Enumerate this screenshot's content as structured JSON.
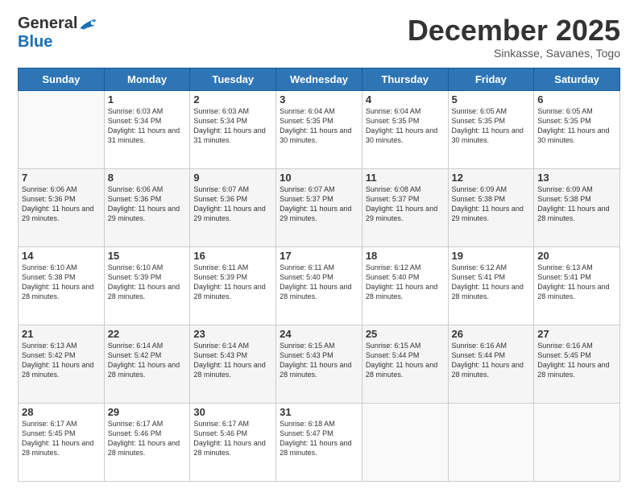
{
  "logo": {
    "general": "General",
    "blue": "Blue"
  },
  "title": "December 2025",
  "location": "Sinkasse, Savanes, Togo",
  "days_of_week": [
    "Sunday",
    "Monday",
    "Tuesday",
    "Wednesday",
    "Thursday",
    "Friday",
    "Saturday"
  ],
  "weeks": [
    [
      {
        "day": "",
        "sunrise": "",
        "sunset": "",
        "daylight": ""
      },
      {
        "day": "1",
        "sunrise": "Sunrise: 6:03 AM",
        "sunset": "Sunset: 5:34 PM",
        "daylight": "Daylight: 11 hours and 31 minutes."
      },
      {
        "day": "2",
        "sunrise": "Sunrise: 6:03 AM",
        "sunset": "Sunset: 5:34 PM",
        "daylight": "Daylight: 11 hours and 31 minutes."
      },
      {
        "day": "3",
        "sunrise": "Sunrise: 6:04 AM",
        "sunset": "Sunset: 5:35 PM",
        "daylight": "Daylight: 11 hours and 30 minutes."
      },
      {
        "day": "4",
        "sunrise": "Sunrise: 6:04 AM",
        "sunset": "Sunset: 5:35 PM",
        "daylight": "Daylight: 11 hours and 30 minutes."
      },
      {
        "day": "5",
        "sunrise": "Sunrise: 6:05 AM",
        "sunset": "Sunset: 5:35 PM",
        "daylight": "Daylight: 11 hours and 30 minutes."
      },
      {
        "day": "6",
        "sunrise": "Sunrise: 6:05 AM",
        "sunset": "Sunset: 5:35 PM",
        "daylight": "Daylight: 11 hours and 30 minutes."
      }
    ],
    [
      {
        "day": "7",
        "sunrise": "Sunrise: 6:06 AM",
        "sunset": "Sunset: 5:36 PM",
        "daylight": "Daylight: 11 hours and 29 minutes."
      },
      {
        "day": "8",
        "sunrise": "Sunrise: 6:06 AM",
        "sunset": "Sunset: 5:36 PM",
        "daylight": "Daylight: 11 hours and 29 minutes."
      },
      {
        "day": "9",
        "sunrise": "Sunrise: 6:07 AM",
        "sunset": "Sunset: 5:36 PM",
        "daylight": "Daylight: 11 hours and 29 minutes."
      },
      {
        "day": "10",
        "sunrise": "Sunrise: 6:07 AM",
        "sunset": "Sunset: 5:37 PM",
        "daylight": "Daylight: 11 hours and 29 minutes."
      },
      {
        "day": "11",
        "sunrise": "Sunrise: 6:08 AM",
        "sunset": "Sunset: 5:37 PM",
        "daylight": "Daylight: 11 hours and 29 minutes."
      },
      {
        "day": "12",
        "sunrise": "Sunrise: 6:09 AM",
        "sunset": "Sunset: 5:38 PM",
        "daylight": "Daylight: 11 hours and 29 minutes."
      },
      {
        "day": "13",
        "sunrise": "Sunrise: 6:09 AM",
        "sunset": "Sunset: 5:38 PM",
        "daylight": "Daylight: 11 hours and 28 minutes."
      }
    ],
    [
      {
        "day": "14",
        "sunrise": "Sunrise: 6:10 AM",
        "sunset": "Sunset: 5:38 PM",
        "daylight": "Daylight: 11 hours and 28 minutes."
      },
      {
        "day": "15",
        "sunrise": "Sunrise: 6:10 AM",
        "sunset": "Sunset: 5:39 PM",
        "daylight": "Daylight: 11 hours and 28 minutes."
      },
      {
        "day": "16",
        "sunrise": "Sunrise: 6:11 AM",
        "sunset": "Sunset: 5:39 PM",
        "daylight": "Daylight: 11 hours and 28 minutes."
      },
      {
        "day": "17",
        "sunrise": "Sunrise: 6:11 AM",
        "sunset": "Sunset: 5:40 PM",
        "daylight": "Daylight: 11 hours and 28 minutes."
      },
      {
        "day": "18",
        "sunrise": "Sunrise: 6:12 AM",
        "sunset": "Sunset: 5:40 PM",
        "daylight": "Daylight: 11 hours and 28 minutes."
      },
      {
        "day": "19",
        "sunrise": "Sunrise: 6:12 AM",
        "sunset": "Sunset: 5:41 PM",
        "daylight": "Daylight: 11 hours and 28 minutes."
      },
      {
        "day": "20",
        "sunrise": "Sunrise: 6:13 AM",
        "sunset": "Sunset: 5:41 PM",
        "daylight": "Daylight: 11 hours and 28 minutes."
      }
    ],
    [
      {
        "day": "21",
        "sunrise": "Sunrise: 6:13 AM",
        "sunset": "Sunset: 5:42 PM",
        "daylight": "Daylight: 11 hours and 28 minutes."
      },
      {
        "day": "22",
        "sunrise": "Sunrise: 6:14 AM",
        "sunset": "Sunset: 5:42 PM",
        "daylight": "Daylight: 11 hours and 28 minutes."
      },
      {
        "day": "23",
        "sunrise": "Sunrise: 6:14 AM",
        "sunset": "Sunset: 5:43 PM",
        "daylight": "Daylight: 11 hours and 28 minutes."
      },
      {
        "day": "24",
        "sunrise": "Sunrise: 6:15 AM",
        "sunset": "Sunset: 5:43 PM",
        "daylight": "Daylight: 11 hours and 28 minutes."
      },
      {
        "day": "25",
        "sunrise": "Sunrise: 6:15 AM",
        "sunset": "Sunset: 5:44 PM",
        "daylight": "Daylight: 11 hours and 28 minutes."
      },
      {
        "day": "26",
        "sunrise": "Sunrise: 6:16 AM",
        "sunset": "Sunset: 5:44 PM",
        "daylight": "Daylight: 11 hours and 28 minutes."
      },
      {
        "day": "27",
        "sunrise": "Sunrise: 6:16 AM",
        "sunset": "Sunset: 5:45 PM",
        "daylight": "Daylight: 11 hours and 28 minutes."
      }
    ],
    [
      {
        "day": "28",
        "sunrise": "Sunrise: 6:17 AM",
        "sunset": "Sunset: 5:45 PM",
        "daylight": "Daylight: 11 hours and 28 minutes."
      },
      {
        "day": "29",
        "sunrise": "Sunrise: 6:17 AM",
        "sunset": "Sunset: 5:46 PM",
        "daylight": "Daylight: 11 hours and 28 minutes."
      },
      {
        "day": "30",
        "sunrise": "Sunrise: 6:17 AM",
        "sunset": "Sunset: 5:46 PM",
        "daylight": "Daylight: 11 hours and 28 minutes."
      },
      {
        "day": "31",
        "sunrise": "Sunrise: 6:18 AM",
        "sunset": "Sunset: 5:47 PM",
        "daylight": "Daylight: 11 hours and 28 minutes."
      },
      {
        "day": "",
        "sunrise": "",
        "sunset": "",
        "daylight": ""
      },
      {
        "day": "",
        "sunrise": "",
        "sunset": "",
        "daylight": ""
      },
      {
        "day": "",
        "sunrise": "",
        "sunset": "",
        "daylight": ""
      }
    ]
  ]
}
